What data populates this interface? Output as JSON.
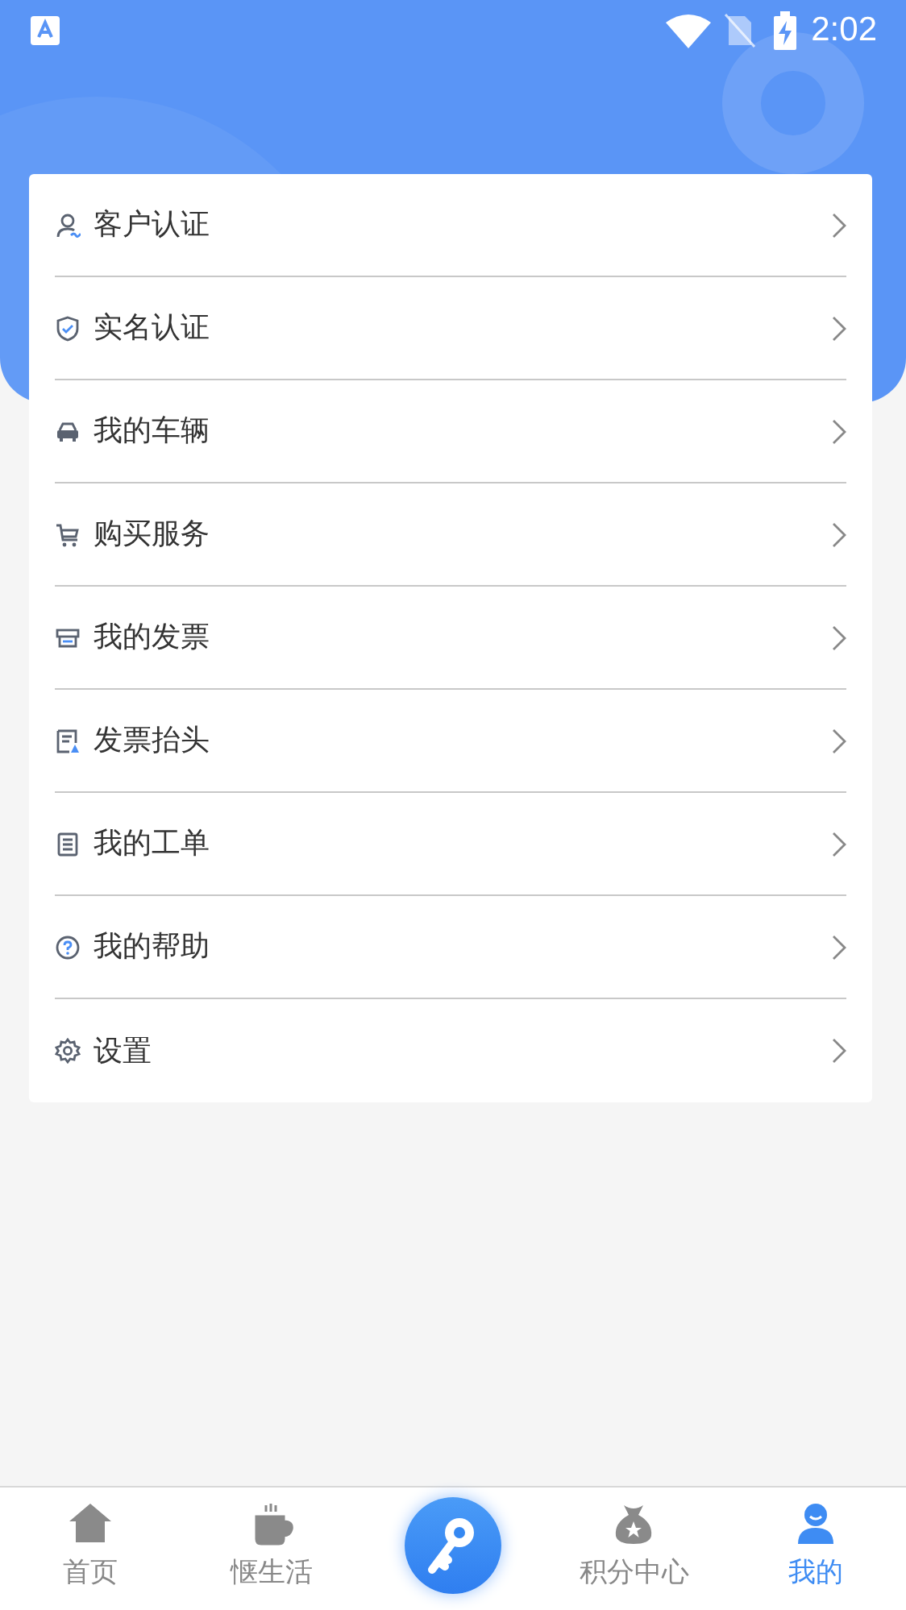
{
  "status_bar": {
    "time": "2:02"
  },
  "menu": [
    {
      "label": "客户认证"
    },
    {
      "label": "实名认证"
    },
    {
      "label": "我的车辆"
    },
    {
      "label": "购买服务"
    },
    {
      "label": "我的发票"
    },
    {
      "label": "发票抬头"
    },
    {
      "label": "我的工单"
    },
    {
      "label": "我的帮助"
    },
    {
      "label": "设置"
    }
  ],
  "tab_bar": [
    {
      "kind": "tab",
      "label": "首页",
      "selected": false
    },
    {
      "kind": "tab",
      "label": "惬生活",
      "selected": false
    },
    {
      "kind": "center"
    },
    {
      "kind": "tab",
      "label": "积分中心",
      "selected": false
    },
    {
      "kind": "tab",
      "label": "我的",
      "selected": true
    }
  ]
}
